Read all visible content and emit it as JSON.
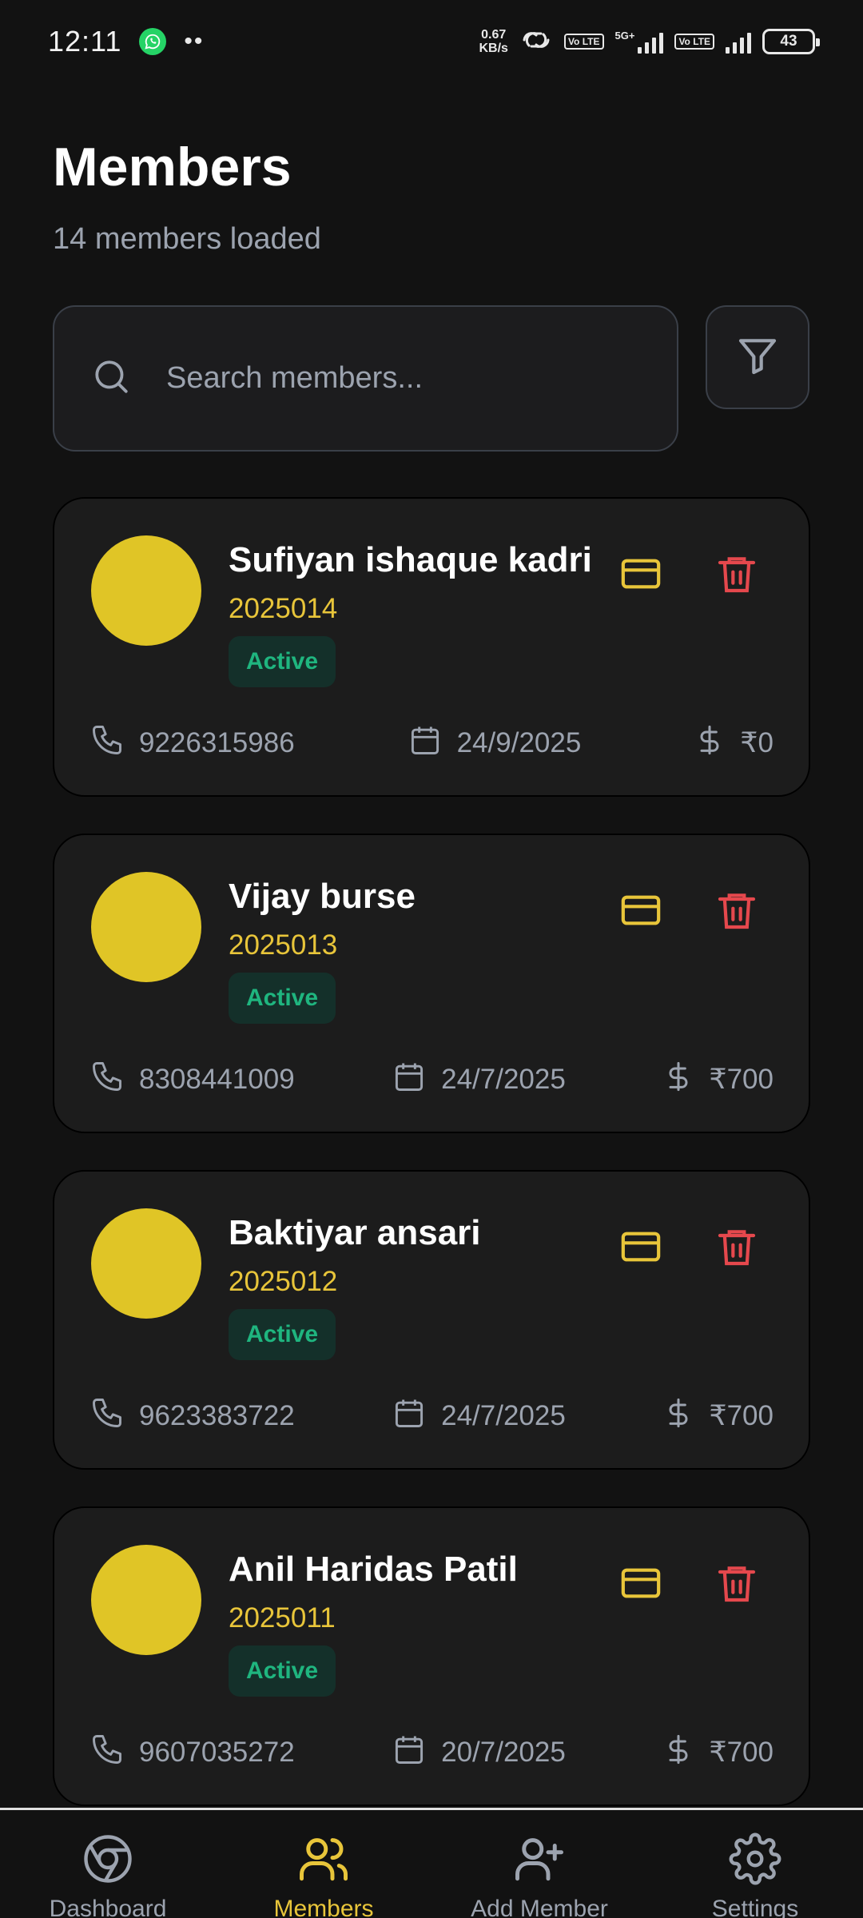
{
  "status_bar": {
    "time": "12:11",
    "dots": "••",
    "speed_value": "0.67",
    "speed_unit": "KB/s",
    "volte_1": "Vo LTE",
    "network": "5G+",
    "volte_2": "Vo LTE",
    "battery": "43"
  },
  "header": {
    "title": "Members",
    "subtitle": "14 members loaded"
  },
  "search": {
    "placeholder": "Search members..."
  },
  "colors": {
    "accent": "#e8c53a",
    "avatar": "#e0c526",
    "danger": "#e5484d",
    "active": "#1fb57f",
    "background": "#121212",
    "card": "#1c1c1c"
  },
  "members": [
    {
      "name": "Sufiyan ishaque kadri",
      "id": "2025014",
      "status": "Active",
      "phone": "9226315986",
      "date": "24/9/2025",
      "amount": "₹0"
    },
    {
      "name": "Vijay burse",
      "id": "2025013",
      "status": "Active",
      "phone": "8308441009",
      "date": "24/7/2025",
      "amount": "₹700"
    },
    {
      "name": "Baktiyar ansari",
      "id": "2025012",
      "status": "Active",
      "phone": "9623383722",
      "date": "24/7/2025",
      "amount": "₹700"
    },
    {
      "name": "Anil Haridas Patil",
      "id": "2025011",
      "status": "Active",
      "phone": "9607035272",
      "date": "20/7/2025",
      "amount": "₹700"
    }
  ],
  "nav": {
    "items": [
      {
        "label": "Dashboard",
        "icon": "chrome-icon",
        "active": false
      },
      {
        "label": "Members",
        "icon": "users-icon",
        "active": true
      },
      {
        "label": "Add Member",
        "icon": "user-plus-icon",
        "active": false
      },
      {
        "label": "Settings",
        "icon": "gear-icon",
        "active": false
      }
    ]
  }
}
